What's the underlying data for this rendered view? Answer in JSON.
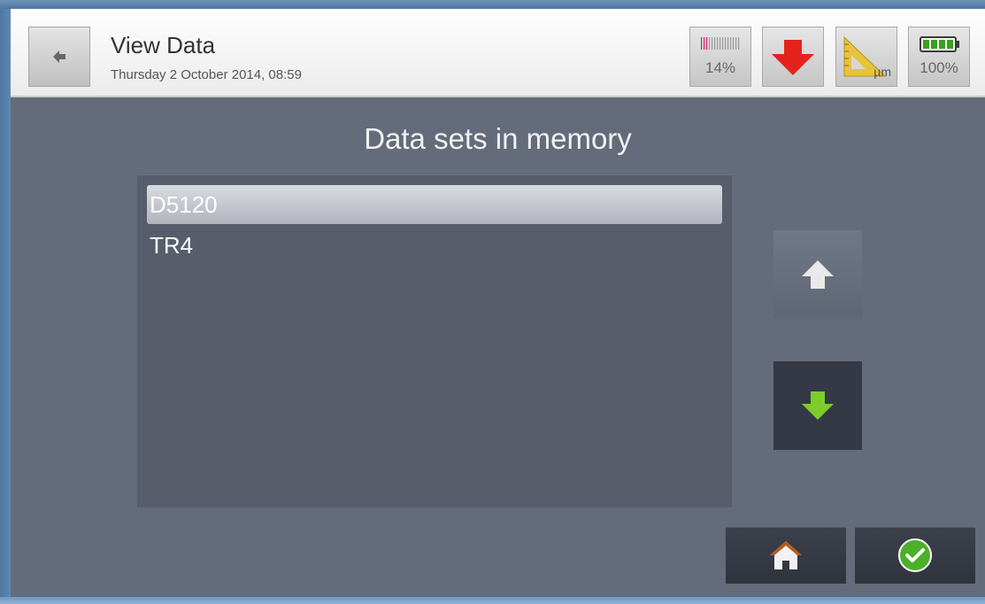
{
  "header": {
    "title": "View Data",
    "subtitle": "Thursday 2 October 2014, 08:59",
    "status": {
      "memory_percent": "14%",
      "unit": "µm",
      "battery_percent": "100%"
    }
  },
  "main": {
    "heading": "Data sets in memory",
    "datasets": [
      {
        "label": "D5120",
        "selected": true
      },
      {
        "label": "TR4",
        "selected": false
      }
    ]
  },
  "icons": {
    "back": "back-arrow-icon",
    "memory": "memory-gauge-icon",
    "download": "red-down-arrow-icon",
    "ruler": "ruler-icon",
    "battery": "battery-icon",
    "scroll_up": "up-arrow-icon",
    "scroll_down": "green-down-arrow-icon",
    "home": "home-icon",
    "ok": "check-circle-icon"
  },
  "colors": {
    "accent_red": "#e5231c",
    "accent_green": "#7ccd2a",
    "background": "#646b7a"
  }
}
